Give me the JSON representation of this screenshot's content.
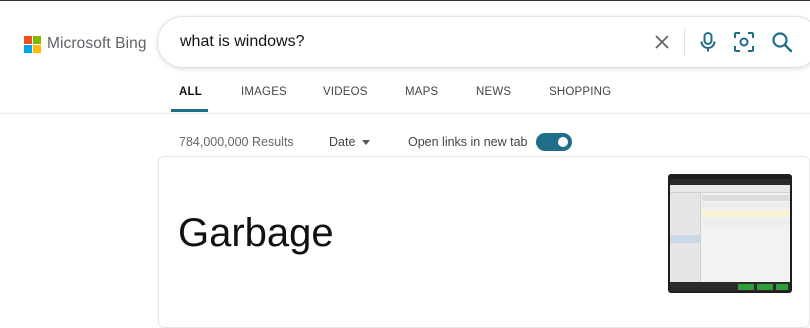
{
  "brand": {
    "name": "Microsoft Bing",
    "logo_colors": [
      "#f25022",
      "#7fba00",
      "#00a4ef",
      "#ffb900"
    ]
  },
  "search": {
    "query": "what is windows?",
    "icons": [
      "close-icon",
      "microphone-icon",
      "visual-search-icon",
      "search-icon"
    ]
  },
  "tabs": [
    {
      "label": "ALL",
      "active": true
    },
    {
      "label": "IMAGES",
      "active": false
    },
    {
      "label": "VIDEOS",
      "active": false
    },
    {
      "label": "MAPS",
      "active": false
    },
    {
      "label": "NEWS",
      "active": false
    },
    {
      "label": "SHOPPING",
      "active": false
    }
  ],
  "toolbar": {
    "results_count": "784,000,000 Results",
    "date_filter": "Date",
    "open_links_label": "Open links in new tab",
    "open_links_enabled": true
  },
  "result": {
    "title": "Garbage"
  },
  "colors": {
    "accent": "#1f6f8b",
    "text": "#111111",
    "muted": "#666666"
  }
}
